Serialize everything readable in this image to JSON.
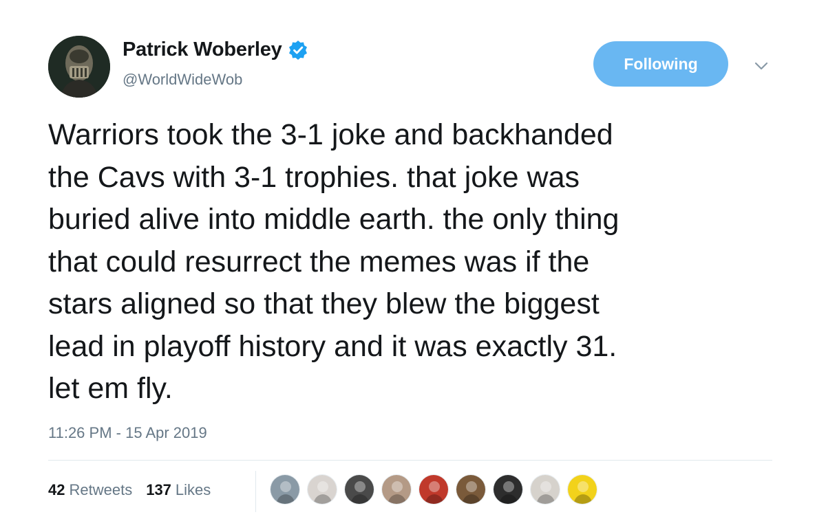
{
  "author": {
    "name": "Patrick Woberley",
    "handle": "@WorldWideWob",
    "verified": true,
    "avatar_icon": "bane-mask-avatar"
  },
  "follow_button": {
    "label": "Following",
    "color": "#69b7f2"
  },
  "menu_icon": "chevron-down-icon",
  "tweet": {
    "text": "Warriors took the 3-1 joke and backhanded\nthe Cavs with 3-1 trophies. that joke was\nburied alive into middle earth. the only thing\nthat could resurrect the memes was if the\nstars aligned so that they blew the biggest\nlead in playoff history and it was exactly 31.\nlet em fly.",
    "timestamp": "11:26 PM - 15 Apr 2019"
  },
  "stats": {
    "retweets": {
      "count": "42",
      "label": "Retweets"
    },
    "likes": {
      "count": "137",
      "label": "Likes"
    }
  },
  "likers": [
    {
      "icon": "user-avatar-icon",
      "color": "#8a9aa6"
    },
    {
      "icon": "user-avatar-icon",
      "color": "#d9d4d0"
    },
    {
      "icon": "user-avatar-icon",
      "color": "#4a4a4a"
    },
    {
      "icon": "user-avatar-icon",
      "color": "#b49a86"
    },
    {
      "icon": "user-avatar-icon",
      "color": "#c0392b"
    },
    {
      "icon": "user-avatar-icon",
      "color": "#7a5a3a"
    },
    {
      "icon": "user-avatar-icon",
      "color": "#2d2d2d"
    },
    {
      "icon": "user-avatar-icon",
      "color": "#d6d2cc"
    },
    {
      "icon": "user-avatar-icon",
      "color": "#f2d21b"
    }
  ]
}
